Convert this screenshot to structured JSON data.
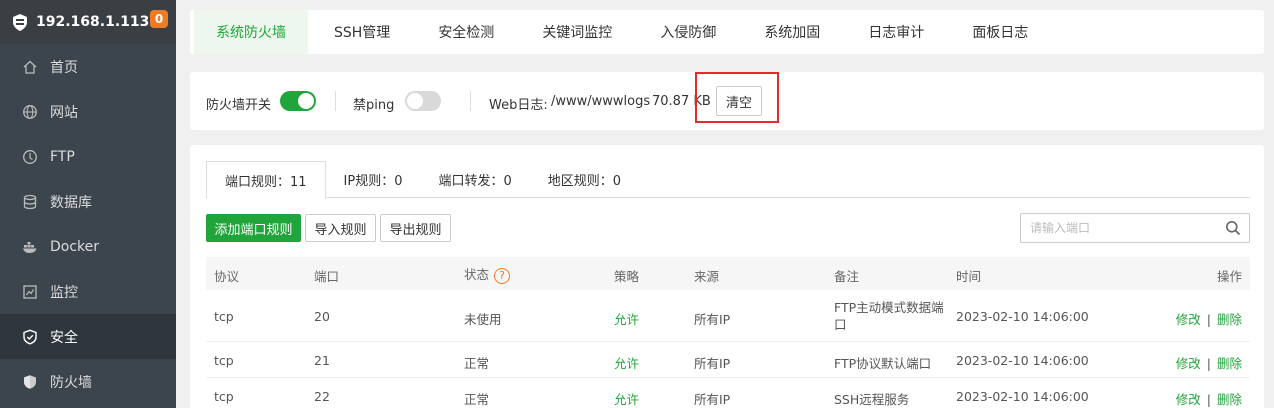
{
  "sidebar": {
    "ip": "192.168.1.113",
    "badge": "0",
    "items": [
      {
        "label": "首页",
        "icon": "home-icon"
      },
      {
        "label": "网站",
        "icon": "globe-icon"
      },
      {
        "label": "FTP",
        "icon": "ftp-icon"
      },
      {
        "label": "数据库",
        "icon": "database-icon"
      },
      {
        "label": "Docker",
        "icon": "docker-icon"
      },
      {
        "label": "监控",
        "icon": "monitor-icon"
      },
      {
        "label": "安全",
        "icon": "shield-check-icon",
        "active": true
      },
      {
        "label": "防火墙",
        "icon": "shield-icon"
      }
    ]
  },
  "top_tabs": [
    "系统防火墙",
    "SSH管理",
    "安全检测",
    "关键词监控",
    "入侵防御",
    "系统加固",
    "日志审计",
    "面板日志"
  ],
  "controls": {
    "firewall_label": "防火墙开关",
    "firewall_on": true,
    "ping_label": "禁ping",
    "ping_on": false,
    "weblog_label": "Web日志:",
    "weblog_path": "/www/wwwlogs",
    "weblog_size": "70.87 KB",
    "clear_label": "清空"
  },
  "sub_tabs": [
    "端口规则：11",
    "IP规则：0",
    "端口转发：0",
    "地区规则：0"
  ],
  "actions": {
    "add_label": "添加端口规则",
    "import_label": "导入规则",
    "export_label": "导出规则",
    "search_placeholder": "请输入端口"
  },
  "table": {
    "headers": {
      "protocol": "协议",
      "port": "端口",
      "status": "状态",
      "status_help": "?",
      "policy": "策略",
      "source": "来源",
      "note": "备注",
      "time": "时间",
      "ops": "操作"
    },
    "rows": [
      {
        "protocol": "tcp",
        "port": "20",
        "status": "未使用",
        "policy": "允许",
        "source": "所有IP",
        "note": "FTP主动模式数据端口",
        "time": "2023-02-10 14:06:00",
        "edit": "修改",
        "sep": "|",
        "delete": "删除"
      },
      {
        "protocol": "tcp",
        "port": "21",
        "status": "正常",
        "policy": "允许",
        "source": "所有IP",
        "note": "FTP协议默认端口",
        "time": "2023-02-10 14:06:00",
        "edit": "修改",
        "sep": "|",
        "delete": "删除"
      },
      {
        "protocol": "tcp",
        "port": "22",
        "status": "正常",
        "policy": "允许",
        "source": "所有IP",
        "note": "SSH远程服务",
        "time": "2023-02-10 14:06:00",
        "edit": "修改",
        "sep": "|",
        "delete": "删除"
      }
    ]
  },
  "colors": {
    "accent": "#20a53a",
    "sidebar": "#3c444d",
    "badge": "#ef7b23",
    "highlight": "#e22b2b"
  }
}
